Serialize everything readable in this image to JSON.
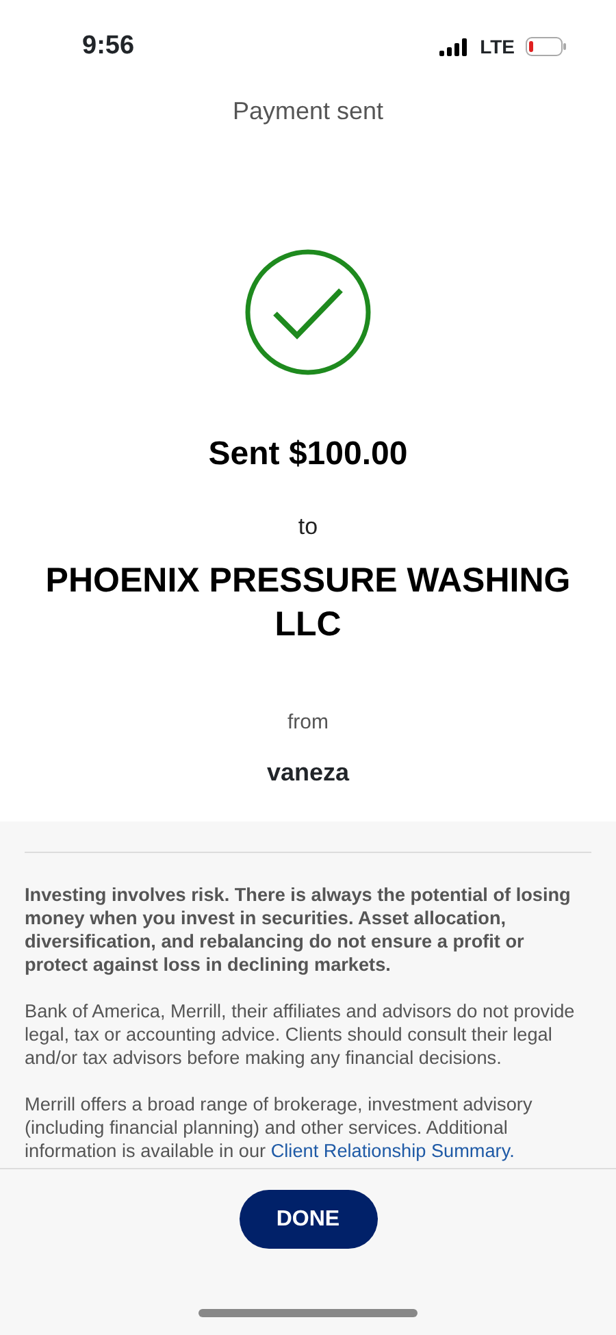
{
  "status_bar": {
    "time": "9:56",
    "network": "LTE"
  },
  "header": {
    "title": "Payment sent"
  },
  "confirmation": {
    "amount_line": "Sent $100.00",
    "to_label": "to",
    "recipient": "PHOENIX PRESSURE WASHING LLC",
    "from_label": "from",
    "sender": "vaneza"
  },
  "disclosures": [
    {
      "kind": "bold",
      "text": "Investing involves risk. There is always the potential of losing money when you invest in securities. Asset allocation, diversification, and rebalancing do not ensure a profit or protect against loss in declining markets."
    },
    {
      "kind": "plain",
      "text": "Bank of America, Merrill, their affiliates and advisors do not provide legal, tax or accounting advice. Clients should consult their legal and/or tax advisors before making any financial decisions."
    },
    {
      "kind": "plain",
      "text": "Merrill offers a broad range of brokerage, investment advisory (including financial planning) and other services. Additional information is available in our",
      "link": "Client Relationship Summary."
    }
  ],
  "footer": {
    "button": "DONE"
  }
}
